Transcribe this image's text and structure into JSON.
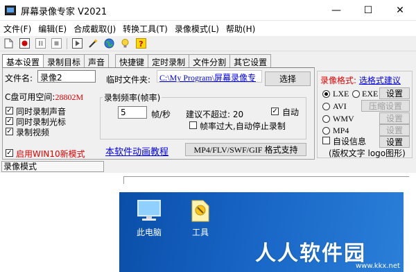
{
  "window": {
    "title": "屏幕录像专家 V2021",
    "minimize": "—",
    "maximize": "☐",
    "close": "✕"
  },
  "menu": [
    "文件(F)",
    "编辑(E)",
    "合成截取(J)",
    "转换工具(T)",
    "录像模式(L)",
    "帮助(H)"
  ],
  "tabs": [
    "基本设置",
    "录制目标",
    "声音",
    "快捷键",
    "定时录制",
    "文件分割",
    "其它设置"
  ],
  "basic": {
    "filename_label": "文件名:",
    "filename_value": "录像2",
    "tempfolder_label": "临时文件夹:",
    "tempfolder_value": "C:\\My Program\\屏幕录像专",
    "select_button": "选择",
    "disk_space_label": "C盘可用空间:",
    "disk_space_value": "28802M",
    "checks": [
      {
        "label": "同时录制声音",
        "checked": true
      },
      {
        "label": "同时录制光标",
        "checked": true
      },
      {
        "label": "录制视频",
        "checked": true
      }
    ],
    "win10_label": "启用WIN10新模式",
    "win10_checked": true,
    "fps_group_title": "录制频率(帧率)",
    "fps_value": "5",
    "fps_unit": "帧/秒",
    "fps_suggest": "建议不超过: 20",
    "auto_label": "自动",
    "auto_checked": true,
    "auto_stop_label": "帧率过大,自动停止录制",
    "auto_stop_checked": false,
    "tutorial_link": "本软件动画教程",
    "format_support_button": "MP4/FLV/SWF/GIF  格式支持"
  },
  "format": {
    "title": "录像格式:",
    "guide_link": "选格式建议",
    "options": [
      {
        "label": "LXE",
        "selected": true
      },
      {
        "label": "EXE",
        "selected": false
      },
      {
        "label": "AVI",
        "selected": false
      },
      {
        "label": "WMV",
        "selected": false
      },
      {
        "label": "MP4",
        "selected": false
      }
    ],
    "settings_label": "设置",
    "compress_settings_label": "压缩设置",
    "custom_info_label": "自设信息",
    "custom_info_checked": false,
    "custom_info_desc": "(版权文字 logo图形)"
  },
  "mode_label": "录像模式",
  "desktop": {
    "items": [
      "此电脑",
      "工具"
    ]
  },
  "watermark": {
    "text": "人人软件园",
    "url": "www.kkx.net"
  },
  "colors": {
    "red": "#e00000",
    "link": "#0000ee",
    "desktop": "#1764c5"
  }
}
